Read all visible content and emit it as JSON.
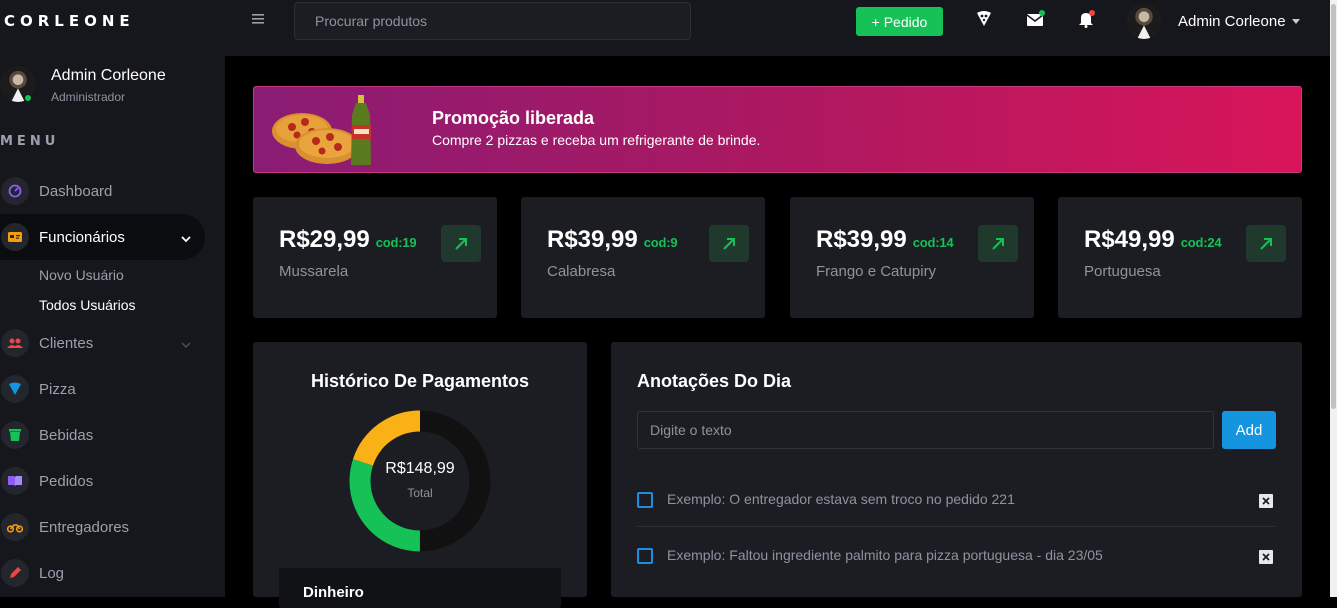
{
  "header": {
    "brand": "CORLEONE",
    "search_placeholder": "Procurar produtos",
    "new_order_label": "+ Pedido",
    "user_name": "Admin Corleone"
  },
  "sidebar": {
    "user_name": "Admin Corleone",
    "user_role": "Administrador",
    "menu_title": "MENU",
    "items": [
      {
        "label": "Dashboard",
        "icon": "speedometer-icon",
        "color": "#8b5cf6"
      },
      {
        "label": "Funcionários",
        "icon": "id-card-icon",
        "color": "#f59e0b"
      },
      {
        "label": "Clientes",
        "icon": "users-icon",
        "color": "#ef4444"
      },
      {
        "label": "Pizza",
        "icon": "pizza-icon",
        "color": "#1594e0"
      },
      {
        "label": "Bebidas",
        "icon": "cup-icon",
        "color": "#16c157"
      },
      {
        "label": "Pedidos",
        "icon": "book-icon",
        "color": "#8b5cf6"
      },
      {
        "label": "Entregadores",
        "icon": "motorbike-icon",
        "color": "#f59e0b"
      },
      {
        "label": "Log",
        "icon": "pencil-icon",
        "color": "#ef4444"
      }
    ],
    "subitems": [
      {
        "label": "Novo Usuário"
      },
      {
        "label": "Todos Usuários"
      }
    ]
  },
  "promo": {
    "title": "Promoção liberada",
    "text": "Compre 2 pizzas e receba um refrigerante de brinde."
  },
  "products": [
    {
      "price": "R$29,99",
      "code": "cod:19",
      "name": "Mussarela"
    },
    {
      "price": "R$39,99",
      "code": "cod:9",
      "name": "Calabresa"
    },
    {
      "price": "R$39,99",
      "code": "cod:14",
      "name": "Frango e Catupiry"
    },
    {
      "price": "R$49,99",
      "code": "cod:24",
      "name": "Portuguesa"
    }
  ],
  "payments": {
    "title": "Histórico De Pagamentos",
    "total": "R$148,99",
    "total_label": "Total",
    "first_row": "Dinheiro",
    "chart_colors": {
      "dark": "#111111",
      "green": "#16c157",
      "yellow": "#f9b115"
    },
    "segment_fractions": {
      "dark": 0.5,
      "green": 0.3,
      "yellow": 0.2
    }
  },
  "notes": {
    "title": "Anotações Do Dia",
    "input_placeholder": "Digite o texto",
    "add_label": "Add",
    "items": [
      {
        "text": "Exemplo: O entregador estava sem troco no pedido 221"
      },
      {
        "text": "Exemplo: Faltou ingrediente palmito para pizza portuguesa - dia 23/05"
      }
    ]
  }
}
